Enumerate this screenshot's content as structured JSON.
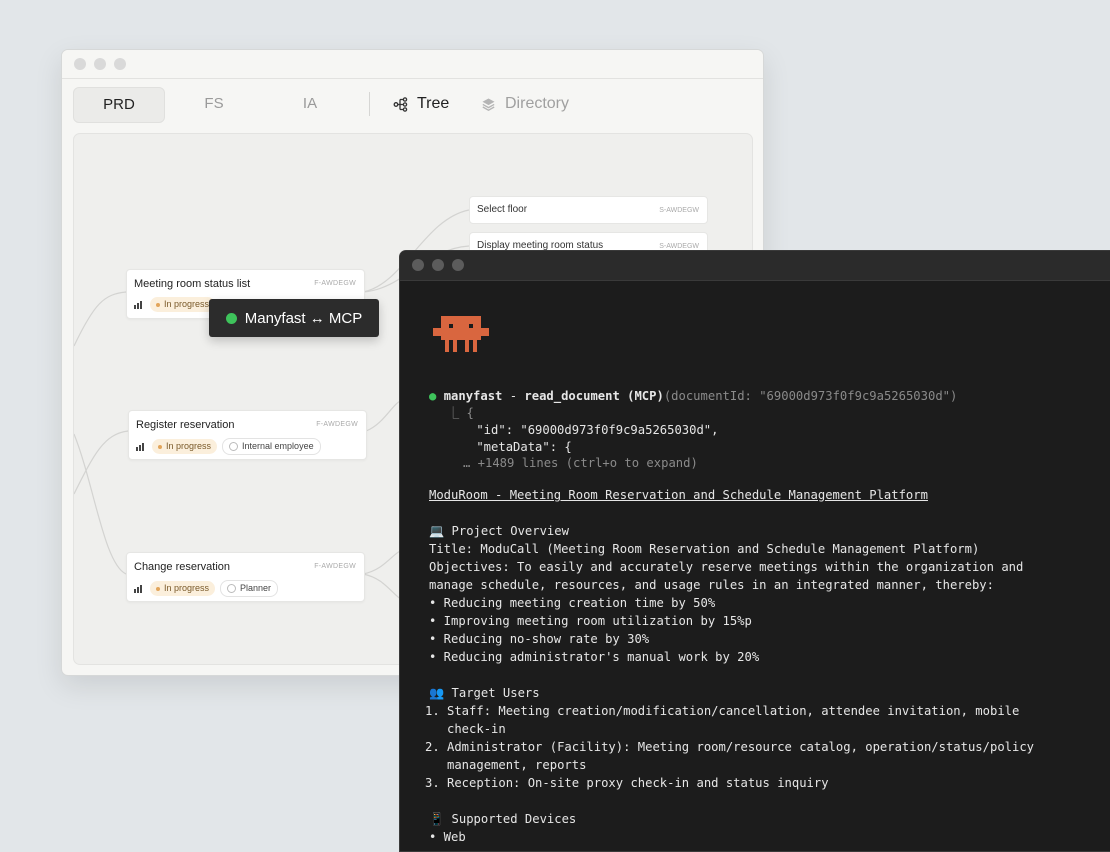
{
  "back_window": {
    "tabs": [
      {
        "label": "PRD",
        "active": true
      },
      {
        "label": "FS",
        "active": false
      },
      {
        "label": "IA",
        "active": false
      }
    ],
    "view_tabs": [
      {
        "label": "Tree",
        "icon": "tree-icon",
        "active": true
      },
      {
        "label": "Directory",
        "icon": "layers-icon",
        "active": false
      }
    ],
    "nodes": [
      {
        "title": "Meeting room status list",
        "code": "F-AWDEGW",
        "status": "In progress",
        "role": ""
      },
      {
        "title": "Register reservation",
        "code": "F-AWDEGW",
        "status": "In progress",
        "role": "Internal employee"
      },
      {
        "title": "Change reservation",
        "code": "F-AWDEGW",
        "status": "In progress",
        "role": "Planner"
      }
    ],
    "leaves": [
      {
        "title": "Select floor",
        "code": "S-AWDEGW"
      },
      {
        "title": "Display meeting room status",
        "code": "S-AWDEGW"
      }
    ]
  },
  "mcp_badge": {
    "label": "Manyfast ↔ MCP",
    "status_color": "#3ec35b"
  },
  "terminal": {
    "call": {
      "server": "manyfast",
      "sep": " - ",
      "tool": "read_document (MCP)",
      "args": "(documentId: \"69000d973f0f9c9a5265030d\")"
    },
    "result_lines": [
      "⎿ {",
      "    \"id\": \"69000d973f0f9c9a5265030d\",",
      "    \"metaData\": {"
    ],
    "collapsed_note": "… +1489 lines (ctrl+o to expand)",
    "doc_title": "ModuRoom - Meeting Room Reservation and Schedule Management Platform",
    "sections": [
      {
        "icon": "💻",
        "heading": "Project Overview",
        "lines": [
          "Title: ModuCall (Meeting Room Reservation and Schedule Management Platform)",
          "Objectives: To easily and accurately reserve meetings within the organization and",
          "manage schedule, resources, and usage rules in an integrated manner, thereby:",
          "• Reducing meeting creation time by 50%",
          "• Improving meeting room utilization by 15%p",
          "• Reducing no-show rate by 30%",
          "• Reducing administrator's manual work by 20%"
        ]
      },
      {
        "icon": "👥",
        "heading": "Target Users",
        "lines": [
          "1. Staff: Meeting creation/modification/cancellation, attendee invitation, mobile",
          "   check-in",
          "2. Administrator (Facility): Meeting room/resource catalog, operation/status/policy",
          "   management, reports",
          "3. Reception: On-site proxy check-in and status inquiry"
        ]
      },
      {
        "icon": "📱",
        "heading": "Supported Devices",
        "lines": [
          "• Web"
        ]
      }
    ]
  },
  "colors": {
    "background": "#e2e6e9",
    "terminal_bg": "#1c1c1c",
    "accent_green": "#3ec35b",
    "mascot": "#d9663f",
    "status_pill_bg": "#fbefdc"
  }
}
